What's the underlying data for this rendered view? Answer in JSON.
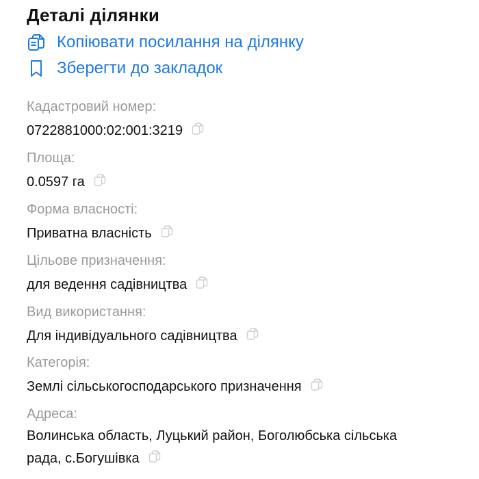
{
  "header": {
    "title": "Деталі ділянки"
  },
  "actions": {
    "copy_link_label": "Копіювати посилання на ділянку",
    "bookmark_label": "Зберегти до закладок"
  },
  "fields": [
    {
      "label": "Кадастровий номер:",
      "value": "0722881000:02:001:3219"
    },
    {
      "label": "Площа:",
      "value": "0.0597 га"
    },
    {
      "label": "Форма власності:",
      "value": "Приватна власність"
    },
    {
      "label": "Цільове призначення:",
      "value": "для ведення садівництва"
    },
    {
      "label": "Вид використання:",
      "value": "Для індивідуального садівництва"
    },
    {
      "label": "Категорія:",
      "value": "Землі сільськогосподарського призначення"
    },
    {
      "label": "Адреса:",
      "value": "Волинська область, Луцький район, Боголюбська сільська рада, с.Богушівка"
    }
  ],
  "colors": {
    "accent": "#1f7ae0",
    "label": "#9a9a9e",
    "text": "#111111",
    "icon_muted": "#cfcfd4"
  },
  "icons": {
    "copy_link": "clipboard-copy-icon",
    "bookmark": "bookmark-icon",
    "copy_value": "copy-icon"
  }
}
